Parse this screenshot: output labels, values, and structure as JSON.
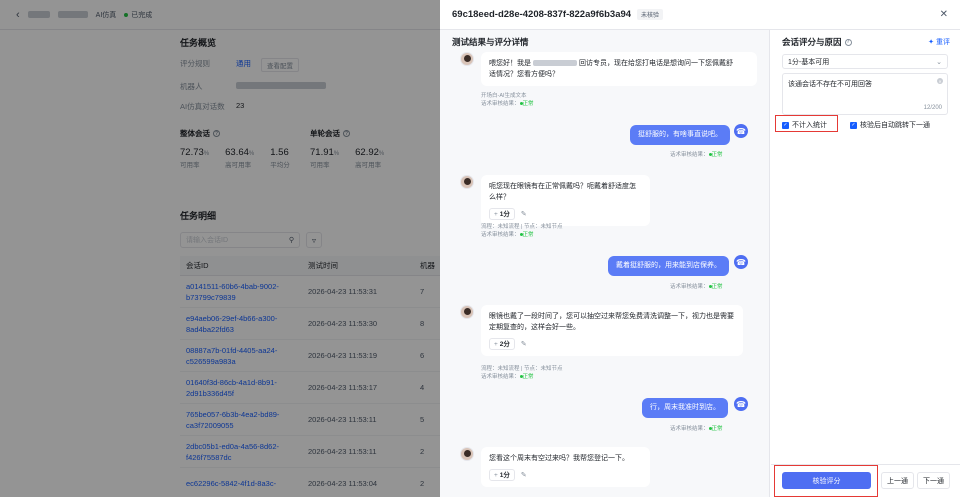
{
  "bg": {
    "tag": "AI仿真",
    "status": "已完成",
    "overview_title": "任务概览",
    "rows": [
      {
        "k": "评分规则",
        "v": "通用",
        "tag": "查看配置"
      },
      {
        "k": "机器人",
        "v": ""
      },
      {
        "k": "AI仿真对话数",
        "v": "23"
      }
    ],
    "group1_title": "整体会话",
    "group2_title": "单轮会话",
    "stats1": [
      {
        "num": "72.73",
        "unit": "%",
        "lbl": "可用率"
      },
      {
        "num": "63.64",
        "unit": "%",
        "lbl": "高可用率"
      },
      {
        "num": "1.56",
        "unit": "",
        "lbl": "平均分"
      }
    ],
    "stats2": [
      {
        "num": "71.91",
        "unit": "%",
        "lbl": "可用率"
      },
      {
        "num": "62.92",
        "unit": "%",
        "lbl": "高可用率"
      }
    ],
    "detail_title": "任务明细",
    "search_placeholder": "请输入会话ID",
    "col_id": "会话ID",
    "col_time": "测试时间",
    "col_bot": "机器",
    "table": [
      {
        "id1": "a0141511-60b6-4bab-9002-",
        "id2": "b73799c79839",
        "time": "2026-04-23 11:53:31",
        "n": "7"
      },
      {
        "id1": "e94aeb06-29ef-4b66-a300-",
        "id2": "8ad4ba22fd63",
        "time": "2026-04-23 11:53:30",
        "n": "8"
      },
      {
        "id1": "08887a7b-01fd-4405-aa24-",
        "id2": "c526599a983a",
        "time": "2026-04-23 11:53:19",
        "n": "6"
      },
      {
        "id1": "01640f3d-86cb-4a1d-8b91-",
        "id2": "2d91b336d45f",
        "time": "2026-04-23 11:53:17",
        "n": "4"
      },
      {
        "id1": "765be057-6b3b-4ea2-bd89-",
        "id2": "ca3f72009055",
        "time": "2026-04-23 11:53:11",
        "n": "5"
      },
      {
        "id1": "2dbc05b1-ed0a-4a56-8d62-",
        "id2": "f426f75587dc",
        "time": "2026-04-23 11:53:11",
        "n": "2"
      },
      {
        "id1": "ec62296c-5842-4f1d-8a3c-",
        "id2": "",
        "time": "2026-04-23 11:53:04",
        "n": "2"
      }
    ]
  },
  "drawer": {
    "title": "69c18eed-d28e-4208-837f-822a9f6b3a94",
    "badge": "未核验",
    "left_title": "测试结果与评分详情",
    "bot_meta": "话术审核结果：",
    "ok": "正常",
    "msg1_a": "喂您好！我是",
    "msg1_b": "回访专员，现在给您打电话是想询问一下您佩戴舒",
    "msg1_c": "适情况？您看方便吗？",
    "msg1_meta": "开场白-AI生成文本",
    "user1": "挺舒服的，有啥事直说吧。",
    "msg2": "呃您现在眼镜有在正常佩戴吗？呃戴着舒适度怎么样？",
    "msg2_score": "1分",
    "msg2_meta1": "流程：未知流程 | 节点：未知节点",
    "user2": "戴着挺舒服的，用来能到店保养。",
    "msg3_a": "眼镜也戴了一段时间了，您可以抽空过来帮您免费清洗调整一下，视力也是需要",
    "msg3_b": "定期复查的，这样会好一些。",
    "msg3_score": "2分",
    "user3": "行，周末我准时到店。",
    "msg4": "您看这个周末有空过来吗？我帮您登记一下。",
    "msg4_score": "1分",
    "right_title": "会话评分与原因",
    "rescore": "重评",
    "select_value": "1分-基本可用",
    "reason": "该通会话不存在不可用回答",
    "reason_count": "12/200",
    "chk1": "不计入统计",
    "chk2": "核验后自动跳转下一通",
    "btn_verify": "核验评分",
    "btn_prev": "上一通",
    "btn_next": "下一通"
  }
}
